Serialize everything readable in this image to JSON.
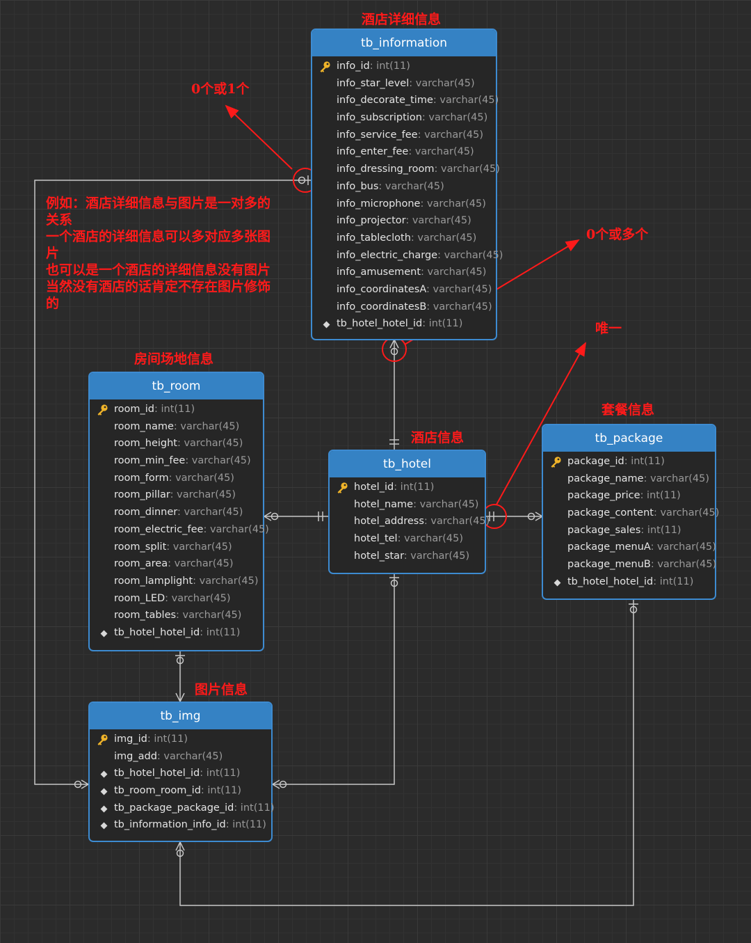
{
  "entities": {
    "information": {
      "name": "tb_information",
      "fields": [
        {
          "name": "info_id",
          "type": ": int(11)",
          "key": "pk"
        },
        {
          "name": "info_star_level",
          "type": ": varchar(45)",
          "key": ""
        },
        {
          "name": "info_decorate_time",
          "type": ": varchar(45)",
          "key": ""
        },
        {
          "name": "info_subscription",
          "type": ": varchar(45)",
          "key": ""
        },
        {
          "name": "info_service_fee",
          "type": ": varchar(45)",
          "key": ""
        },
        {
          "name": "info_enter_fee",
          "type": ": varchar(45)",
          "key": ""
        },
        {
          "name": "info_dressing_room",
          "type": ": varchar(45)",
          "key": ""
        },
        {
          "name": "info_bus",
          "type": ": varchar(45)",
          "key": ""
        },
        {
          "name": "info_microphone",
          "type": ": varchar(45)",
          "key": ""
        },
        {
          "name": "info_projector",
          "type": ": varchar(45)",
          "key": ""
        },
        {
          "name": "info_tablecloth",
          "type": ": varchar(45)",
          "key": ""
        },
        {
          "name": "info_electric_charge",
          "type": ": varchar(45)",
          "key": ""
        },
        {
          "name": "info_amusement",
          "type": ": varchar(45)",
          "key": ""
        },
        {
          "name": "info_coordinatesA",
          "type": ": varchar(45)",
          "key": ""
        },
        {
          "name": "info_coordinatesB",
          "type": ": varchar(45)",
          "key": ""
        },
        {
          "name": "tb_hotel_hotel_id",
          "type": ": int(11)",
          "key": "fk"
        }
      ]
    },
    "room": {
      "name": "tb_room",
      "fields": [
        {
          "name": "room_id",
          "type": ": int(11)",
          "key": "pk"
        },
        {
          "name": "room_name",
          "type": ": varchar(45)",
          "key": ""
        },
        {
          "name": "room_height",
          "type": ": varchar(45)",
          "key": ""
        },
        {
          "name": "room_min_fee",
          "type": ": varchar(45)",
          "key": ""
        },
        {
          "name": "room_form",
          "type": ": varchar(45)",
          "key": ""
        },
        {
          "name": "room_pillar",
          "type": ": varchar(45)",
          "key": ""
        },
        {
          "name": "room_dinner",
          "type": ": varchar(45)",
          "key": ""
        },
        {
          "name": "room_electric_fee",
          "type": ": varchar(45)",
          "key": ""
        },
        {
          "name": "room_split",
          "type": ": varchar(45)",
          "key": ""
        },
        {
          "name": "room_area",
          "type": ": varchar(45)",
          "key": ""
        },
        {
          "name": "room_lamplight",
          "type": ": varchar(45)",
          "key": ""
        },
        {
          "name": "room_LED",
          "type": ": varchar(45)",
          "key": ""
        },
        {
          "name": "room_tables",
          "type": ": varchar(45)",
          "key": ""
        },
        {
          "name": "tb_hotel_hotel_id",
          "type": ": int(11)",
          "key": "fk"
        }
      ]
    },
    "hotel": {
      "name": "tb_hotel",
      "fields": [
        {
          "name": "hotel_id",
          "type": ": int(11)",
          "key": "pk"
        },
        {
          "name": "hotel_name",
          "type": ": varchar(45)",
          "key": ""
        },
        {
          "name": "hotel_address",
          "type": ": varchar(45)",
          "key": ""
        },
        {
          "name": "hotel_tel",
          "type": ": varchar(45)",
          "key": ""
        },
        {
          "name": "hotel_star",
          "type": ": varchar(45)",
          "key": ""
        }
      ]
    },
    "package": {
      "name": "tb_package",
      "fields": [
        {
          "name": "package_id",
          "type": ": int(11)",
          "key": "pk"
        },
        {
          "name": "package_name",
          "type": ": varchar(45)",
          "key": ""
        },
        {
          "name": "package_price",
          "type": ": int(11)",
          "key": ""
        },
        {
          "name": "package_content",
          "type": ": varchar(45)",
          "key": ""
        },
        {
          "name": "package_sales",
          "type": ": int(11)",
          "key": ""
        },
        {
          "name": "package_menuA",
          "type": ": varchar(45)",
          "key": ""
        },
        {
          "name": "package_menuB",
          "type": ": varchar(45)",
          "key": ""
        },
        {
          "name": "tb_hotel_hotel_id",
          "type": ": int(11)",
          "key": "fk"
        }
      ]
    },
    "img": {
      "name": "tb_img",
      "fields": [
        {
          "name": "img_id",
          "type": ": int(11)",
          "key": "pk"
        },
        {
          "name": "img_add",
          "type": ": varchar(45)",
          "key": ""
        },
        {
          "name": "tb_hotel_hotel_id",
          "type": ": int(11)",
          "key": "fk"
        },
        {
          "name": "tb_room_room_id",
          "type": ": int(11)",
          "key": "fk"
        },
        {
          "name": "tb_package_package_id",
          "type": ": int(11)",
          "key": "fk"
        },
        {
          "name": "tb_information_info_id",
          "type": ": int(11)",
          "key": "fk"
        }
      ]
    }
  },
  "labels": {
    "information": "酒店详细信息",
    "room": "房间场地信息",
    "hotel": "酒店信息",
    "package": "套餐信息",
    "img": "图片信息",
    "zero_or_one": "0个或1个",
    "zero_or_many": "0个或多个",
    "unique": "唯一"
  },
  "note": {
    "lines": [
      "例如：酒店详细信息与图片是一对多的关系",
      "一个酒店的详细信息可以多对应多张图片",
      "也可以是一个酒店的详细信息没有图片",
      "当然没有酒店的话肯定不存在图片修饰的"
    ]
  },
  "colors": {
    "header": "#3582c4",
    "border": "#3d8bd1",
    "annotation": "#ff1a1a",
    "line": "#c8c8c8",
    "key": "#f0b429"
  }
}
